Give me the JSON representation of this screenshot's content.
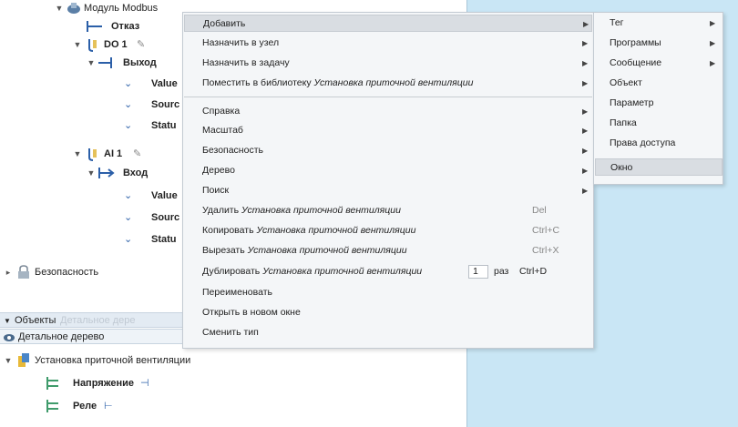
{
  "tree": {
    "module_label": "Модуль Modbus",
    "nodes": [
      {
        "label": "Отказ"
      },
      {
        "label": "DO 1"
      },
      {
        "label": "Выход"
      },
      {
        "label": "Value"
      },
      {
        "label": "Sourc"
      },
      {
        "label": "Statu"
      },
      {
        "label": "AI 1"
      },
      {
        "label": "Вход"
      },
      {
        "label": "Value"
      },
      {
        "label": "Sourc"
      },
      {
        "label": "Statu"
      }
    ],
    "security_label": "Безопасность"
  },
  "objects_bar": {
    "label": "Объекты",
    "faint": "Детальное дере"
  },
  "detail_bar": {
    "label": "Детальное дерево"
  },
  "objects_tree": {
    "root_label": "Установка приточной вентиляции",
    "children": [
      {
        "label": "Напряжение",
        "suffix": "⊣"
      },
      {
        "label": "Реле",
        "suffix": "⊢"
      }
    ]
  },
  "context_menu": {
    "items": [
      {
        "label": "Добавить",
        "highlighted": true,
        "submenu": true
      },
      {
        "label": "Назначить в узел",
        "submenu": true
      },
      {
        "label": "Назначить в задачу",
        "submenu": true
      },
      {
        "label": "Поместить в библиотеку",
        "target": "Установка приточной вентиляции",
        "submenu": true
      },
      {
        "label": "Справка",
        "submenu": true
      },
      {
        "label": "Масштаб",
        "submenu": true
      },
      {
        "label": "Безопасность",
        "submenu": true
      },
      {
        "label": "Дерево",
        "submenu": true
      },
      {
        "label": "Поиск",
        "submenu": true
      },
      {
        "label": "Удалить",
        "target": "Установка приточной вентиляции",
        "shortcut": "Del"
      },
      {
        "label": "Копировать",
        "target": "Установка приточной вентиляции",
        "shortcut": "Ctrl+C"
      },
      {
        "label": "Вырезать",
        "target": "Установка приточной вентиляции",
        "shortcut": "Ctrl+X"
      },
      {
        "label": "Дублировать",
        "target": "Установка приточной вентиляции",
        "count": "1",
        "times_label": "раз",
        "shortcut": "Ctrl+D"
      },
      {
        "label": "Переименовать"
      },
      {
        "label": "Открыть в новом окне"
      },
      {
        "label": "Сменить тип"
      }
    ]
  },
  "submenu": {
    "items": [
      {
        "label": "Тег",
        "submenu": true
      },
      {
        "label": "Программы",
        "submenu": true
      },
      {
        "label": "Сообщение",
        "submenu": true
      },
      {
        "label": "Объект"
      },
      {
        "label": "Параметр"
      },
      {
        "label": "Папка"
      },
      {
        "label": "Права доступа"
      },
      {
        "label": "Окно",
        "highlighted": true
      }
    ]
  },
  "colors": {
    "right_pane_bg": "#c9e6f5",
    "menu_bg": "#f4f6f8",
    "menu_highlight": "#d9dde2",
    "tree_icon_blue": "#2b5fa8",
    "folder_yellow": "#e8b938"
  }
}
